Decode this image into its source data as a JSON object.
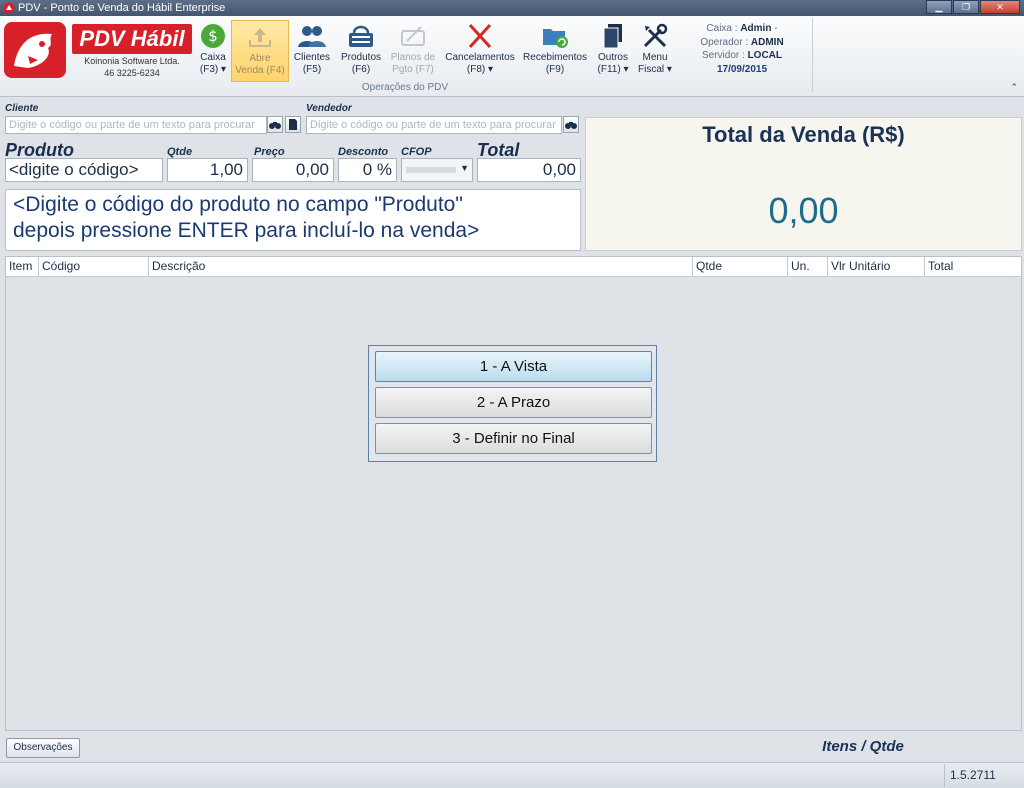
{
  "window": {
    "title": "PDV - Ponto de Venda do Hábil Enterprise"
  },
  "logo": {
    "brand": "PDV Hábil",
    "company": "Koinonia Software Ltda.",
    "phone": "46 3225-6234"
  },
  "ribbon": {
    "buttons": [
      {
        "line1": "Caixa",
        "line2": "(F3) ▾",
        "icon": "dollar-icon"
      },
      {
        "line1": "Abre",
        "line2": "Venda (F4)",
        "icon": "upload-tray-icon"
      },
      {
        "line1": "Clientes",
        "line2": "(F5)",
        "icon": "users-icon"
      },
      {
        "line1": "Produtos",
        "line2": "(F6)",
        "icon": "basket-icon"
      },
      {
        "line1": "Planos de",
        "line2": "Pgto (F7)",
        "icon": "card-icon"
      },
      {
        "line1": "Cancelamentos",
        "line2": "(F8) ▾",
        "icon": "x-icon"
      },
      {
        "line1": "Recebimentos",
        "line2": "(F9)",
        "icon": "folder-refresh-icon"
      },
      {
        "line1": "Outros",
        "line2": "(F11) ▾",
        "icon": "documents-icon"
      },
      {
        "line1": "Menu",
        "line2": "Fiscal ▾",
        "icon": "tools-icon"
      }
    ],
    "group_label": "Operações do PDV",
    "info": {
      "caixa_label": "Caixa :",
      "caixa_value": "Admin",
      "caixa_suffix": "-",
      "operador_label": "Operador :",
      "operador_value": "ADMIN",
      "servidor_label": "Servidor :",
      "servidor_value": "LOCAL",
      "date": "17/09/2015"
    }
  },
  "form": {
    "cliente_label": "Cliente",
    "cliente_placeholder": "Digite o código ou parte de um texto para procurar",
    "vendedor_label": "Vendedor",
    "vendedor_placeholder": "Digite o código ou parte de um texto para procurar",
    "produto_label": "Produto",
    "produto_value": "<digite o código>",
    "qtde_label": "Qtde",
    "qtde_value": "1,00",
    "preco_label": "Preço",
    "preco_value": "0,00",
    "desconto_label": "Desconto",
    "desconto_value": "0 %",
    "cfop_label": "CFOP",
    "total_label": "Total",
    "total_value": "0,00"
  },
  "total_box": {
    "title": "Total da Venda (R$)",
    "value": "0,00"
  },
  "hint": {
    "line1": "<Digite o código do produto no campo \"Produto\"",
    "line2": "depois pressione ENTER para incluí-lo na venda>"
  },
  "grid": {
    "columns": [
      "Item",
      "Código",
      "Descrição",
      "Qtde",
      "Un.",
      "Vlr Unitário",
      "Total"
    ]
  },
  "dialog": {
    "options": [
      "1 - A Vista",
      "2 - A Prazo",
      "3 - Definir no Final"
    ]
  },
  "footer": {
    "obs_label": "Observações",
    "itens_label": "Itens / Qtde",
    "version": "1.5.2711"
  },
  "colors": {
    "brand_red": "#d8202a",
    "accent_blue": "#1b3258"
  }
}
